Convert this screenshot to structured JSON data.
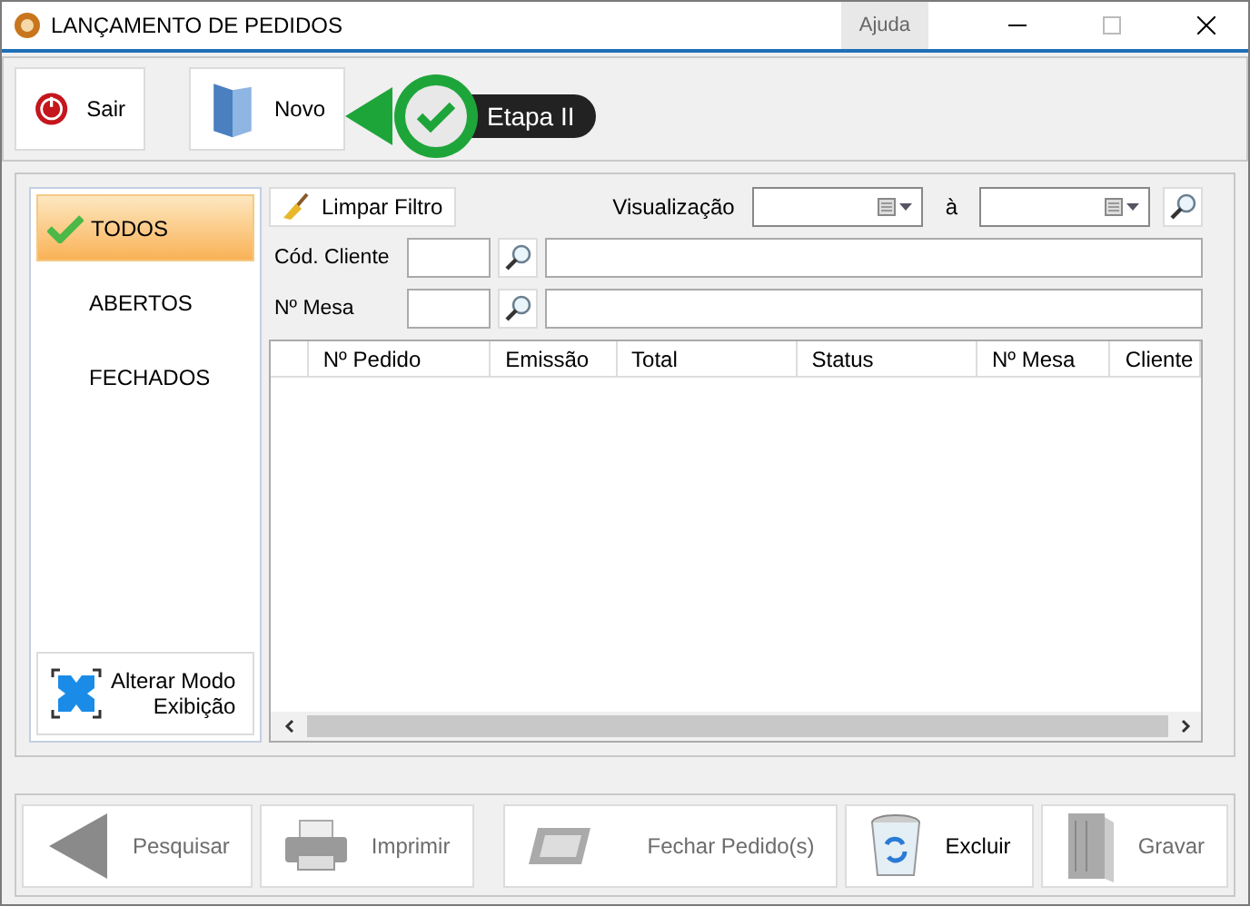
{
  "window": {
    "title": "LANÇAMENTO DE PEDIDOS",
    "help": "Ajuda"
  },
  "toolbar": [
    {
      "kind": "power",
      "label": "Sair",
      "disabled": false
    },
    {
      "kind": "folder",
      "label": "Novo",
      "disabled": false
    }
  ],
  "callout": {
    "label": "Etapa II"
  },
  "filters": [
    {
      "label": "TODOS",
      "selected": true
    },
    {
      "label": "ABERTOS",
      "selected": false
    },
    {
      "label": "FECHADOS",
      "selected": false
    }
  ],
  "view_mode_button": {
    "label_1": "Alterar Modo",
    "label_2": "Exibição"
  },
  "clear_filter": "Limpar Filtro",
  "date_range": {
    "label": "Visualização",
    "separator": "à"
  },
  "fields": [
    {
      "label": "Cód. Cliente"
    },
    {
      "label": "Nº Mesa"
    }
  ],
  "table": {
    "columns": [
      "Nº Pedido",
      "Emissão",
      "Total",
      "Status",
      "Nº Mesa",
      "Cliente"
    ]
  },
  "bottom_buttons": [
    {
      "kind": "back",
      "label": "Pesquisar",
      "disabled": true
    },
    {
      "kind": "printer",
      "label": "Imprimir",
      "disabled": true
    },
    {
      "kind": "spacer"
    },
    {
      "kind": "tray",
      "label": "Fechar Pedido(s)",
      "disabled": true
    },
    {
      "kind": "trash",
      "label": "Excluir",
      "disabled": false
    },
    {
      "kind": "book",
      "label": "Gravar",
      "disabled": true
    }
  ]
}
